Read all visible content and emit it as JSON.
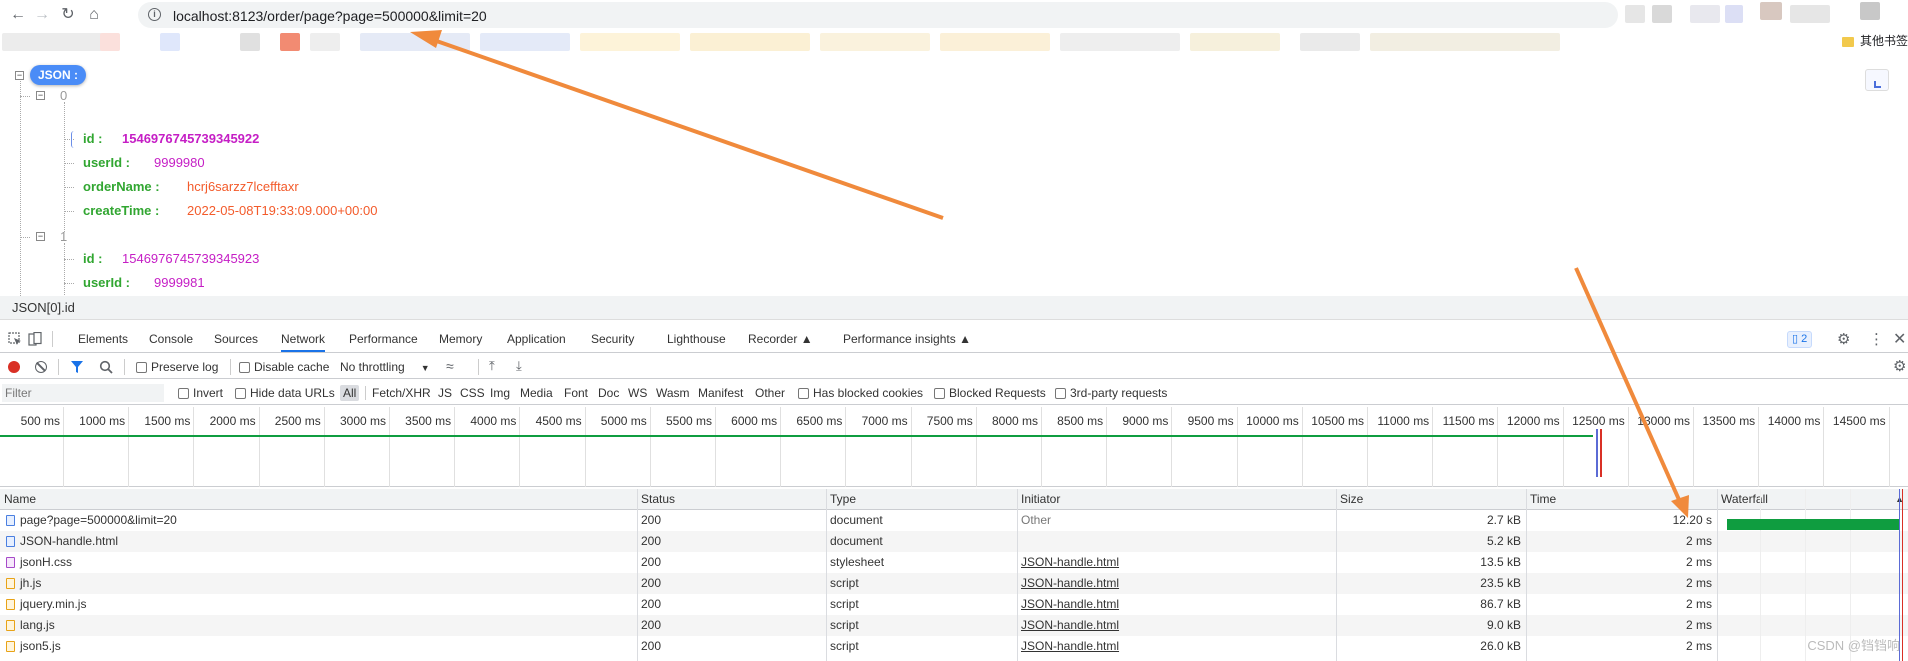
{
  "browser": {
    "url": "localhost:8123/order/page?page=500000&limit=20",
    "other_bookmarks": "其他书签"
  },
  "json_viewer": {
    "root_label": "JSON :",
    "items": [
      {
        "index": "0",
        "id_key": "id :",
        "id": "1546976745739345922",
        "userId_key": "userId :",
        "userId": "9999980",
        "orderName_key": "orderName :",
        "orderName": "hcrj6sarzz7lcefftaxr",
        "createTime_key": "createTime :",
        "createTime": "2022-05-08T19:33:09.000+00:00"
      },
      {
        "index": "1",
        "id_key": "id :",
        "id": "1546976745739345923",
        "userId_key": "userId :",
        "userId": "9999981"
      }
    ]
  },
  "devtools": {
    "status_path": "JSON[0].id",
    "tabs": [
      "Elements",
      "Console",
      "Sources",
      "Network",
      "Performance",
      "Memory",
      "Application",
      "Security",
      "Lighthouse",
      "Recorder",
      "Performance insights"
    ],
    "issues_count": "2",
    "toolbar": {
      "preserve_log": "Preserve log",
      "disable_cache": "Disable cache",
      "throttling": "No throttling"
    },
    "filter": {
      "placeholder": "Filter",
      "invert": "Invert",
      "hide_data_urls": "Hide data URLs",
      "types": [
        "All",
        "Fetch/XHR",
        "JS",
        "CSS",
        "Img",
        "Media",
        "Font",
        "Doc",
        "WS",
        "Wasm",
        "Manifest",
        "Other"
      ],
      "has_blocked_cookies": "Has blocked cookies",
      "blocked_requests": "Blocked Requests",
      "third_party": "3rd-party requests"
    },
    "timeline_ticks": [
      "500 ms",
      "1000 ms",
      "1500 ms",
      "2000 ms",
      "2500 ms",
      "3000 ms",
      "3500 ms",
      "4000 ms",
      "4500 ms",
      "5000 ms",
      "5500 ms",
      "6000 ms",
      "6500 ms",
      "7000 ms",
      "7500 ms",
      "8000 ms",
      "8500 ms",
      "9000 ms",
      "9500 ms",
      "10000 ms",
      "10500 ms",
      "11000 ms",
      "11500 ms",
      "12000 ms",
      "12500 ms",
      "13000 ms",
      "13500 ms",
      "14000 ms",
      "14500 ms"
    ],
    "columns": {
      "name": "Name",
      "status": "Status",
      "type": "Type",
      "initiator": "Initiator",
      "size": "Size",
      "time": "Time",
      "waterfall": "Waterfall"
    },
    "requests": [
      {
        "name": "page?page=500000&limit=20",
        "icon": "doc",
        "status": "200",
        "type": "document",
        "initiator": "Other",
        "size": "2.7 kB",
        "time": "12.20 s"
      },
      {
        "name": "JSON-handle.html",
        "icon": "doc",
        "status": "200",
        "type": "document",
        "initiator": "",
        "size": "5.2 kB",
        "time": "2 ms"
      },
      {
        "name": "jsonH.css",
        "icon": "css",
        "status": "200",
        "type": "stylesheet",
        "initiator": "JSON-handle.html",
        "size": "13.5 kB",
        "time": "2 ms"
      },
      {
        "name": "jh.js",
        "icon": "js",
        "status": "200",
        "type": "script",
        "initiator": "JSON-handle.html",
        "size": "23.5 kB",
        "time": "2 ms"
      },
      {
        "name": "jquery.min.js",
        "icon": "js",
        "status": "200",
        "type": "script",
        "initiator": "JSON-handle.html",
        "size": "86.7 kB",
        "time": "2 ms"
      },
      {
        "name": "lang.js",
        "icon": "js",
        "status": "200",
        "type": "script",
        "initiator": "JSON-handle.html",
        "size": "9.0 kB",
        "time": "2 ms"
      },
      {
        "name": "json5.js",
        "icon": "js",
        "status": "200",
        "type": "script",
        "initiator": "JSON-handle.html",
        "size": "26.0 kB",
        "time": "2 ms"
      }
    ],
    "watermark": "CSDN @铛铛响"
  },
  "colors": {
    "accent": "#1a73e8",
    "json_key": "#31a631",
    "json_number": "#c51ec5",
    "json_string": "#f35b2b",
    "annotation_arrow": "#f08a3c",
    "waterfall_bar": "#0f9d40"
  }
}
